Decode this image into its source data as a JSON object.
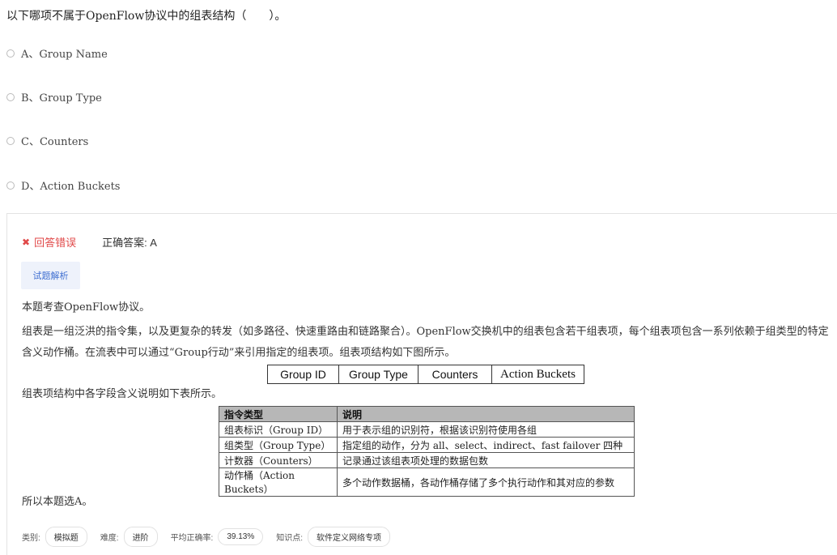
{
  "question": "以下哪项不属于OpenFlow协议中的组表结构（　　）。",
  "options": [
    {
      "label": "A、Group Name"
    },
    {
      "label": "B、Group Type"
    },
    {
      "label": "C、Counters"
    },
    {
      "label": "D、Action Buckets"
    }
  ],
  "result": {
    "wrong_icon": "✖",
    "wrong_text": "回答错误",
    "correct_answer": "正确答案: A"
  },
  "analysis_button": "试题解析",
  "explanation": {
    "p1": "本题考查OpenFlow协议。",
    "p2": "组表是一组泛洪的指令集，以及更复杂的转发（如多路径、快速重路由和链路聚合）。OpenFlow交换机中的组表包含若干组表项，每个组表项包含一系列依赖于组类型的特定含义动作桶。在流表中可以通过“Group行动”来引用指定的组表项。组表项结构如下图所示。",
    "p3": "组表项结构中各字段含义说明如下表所示。",
    "p4": "所以本题选A。"
  },
  "structure_fields": [
    "Group ID",
    "Group Type",
    "Counters",
    "Action Buckets"
  ],
  "field_table": {
    "headers": [
      "指令类型",
      "说明"
    ],
    "rows": [
      [
        "组表标识（Group ID）",
        "用于表示组的识别符，根据该识别符使用各组"
      ],
      [
        "组类型（Group Type）",
        "指定组的动作，分为 all、select、indirect、fast failover 四种"
      ],
      [
        "计数器（Counters）",
        "记录通过该组表项处理的数据包数"
      ],
      [
        "动作桶（Action Buckets）",
        "多个动作数据桶，各动作桶存储了多个执行动作和其对应的参数"
      ]
    ]
  },
  "meta": {
    "category_label": "类别:",
    "category": "模拟题",
    "difficulty_label": "难度:",
    "difficulty": "进阶",
    "accuracy_label": "平均正确率:",
    "accuracy": "39.13%",
    "knowledge_label": "知识点:",
    "knowledge": "软件定义网络专项"
  },
  "colors": {
    "wrong": "#e04848",
    "button_bg": "#eef2fb",
    "button_text": "#3f6fd1"
  }
}
